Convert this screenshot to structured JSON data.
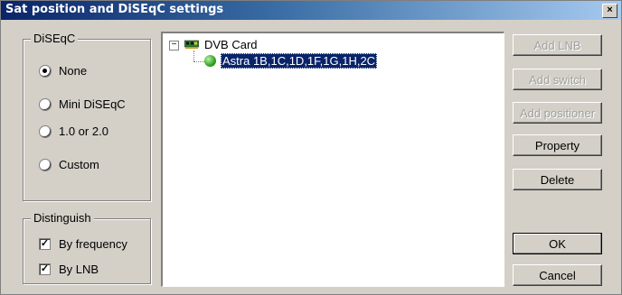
{
  "window": {
    "title": "Sat position and DiSEqC settings",
    "close_glyph": "×"
  },
  "diseqc": {
    "legend": "DiSEqC",
    "options": [
      {
        "label": "None",
        "selected": true
      },
      {
        "label": "Mini DiSEqC",
        "selected": false
      },
      {
        "label": "1.0 or 2.0",
        "selected": false
      },
      {
        "label": "Custom",
        "selected": false
      }
    ]
  },
  "distinguish": {
    "legend": "Distinguish",
    "options": [
      {
        "label": "By frequency",
        "checked": true
      },
      {
        "label": "By LNB",
        "checked": true
      }
    ]
  },
  "tree": {
    "expander": "−",
    "root": {
      "label": "DVB Card",
      "icon": "pci-card-icon"
    },
    "children": [
      {
        "label": "Astra 1B,1C,1D,1F,1G,1H,2C",
        "icon": "satellite-icon",
        "selected": true
      }
    ]
  },
  "buttons": {
    "add_lnb": {
      "label": "Add LNB",
      "enabled": false
    },
    "add_switch": {
      "label": "Add switch",
      "enabled": false
    },
    "add_positioner": {
      "label": "Add positioner",
      "enabled": false
    },
    "property": {
      "label": "Property",
      "enabled": true
    },
    "delete": {
      "label": "Delete",
      "enabled": true
    },
    "ok": {
      "label": "OK",
      "enabled": true
    },
    "cancel": {
      "label": "Cancel",
      "enabled": true
    }
  },
  "colors": {
    "title_start": "#0a246a",
    "title_end": "#a6caf0",
    "face": "#d4d0c8",
    "selection": "#0a246a"
  }
}
